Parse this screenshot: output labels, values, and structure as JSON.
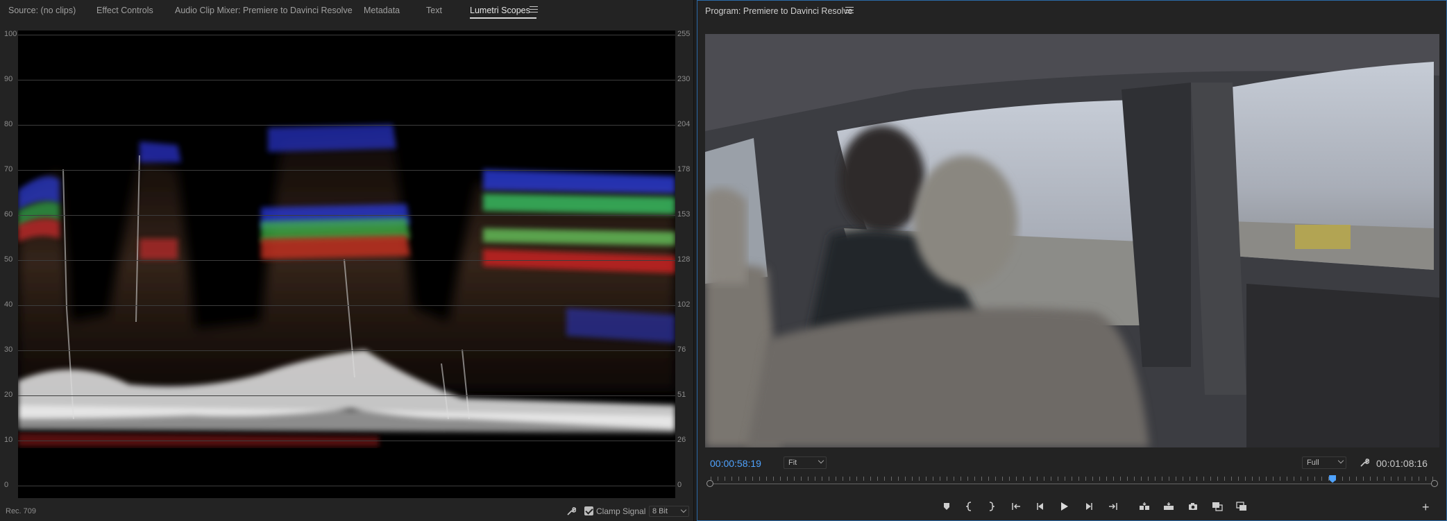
{
  "left_panel": {
    "tabs": [
      {
        "label": "Source: (no clips)"
      },
      {
        "label": "Effect Controls"
      },
      {
        "label": "Audio Clip Mixer: Premiere to Davinci Resolve"
      },
      {
        "label": "Metadata"
      },
      {
        "label": "Text"
      },
      {
        "label": "Lumetri Scopes",
        "active": true
      }
    ],
    "scope": {
      "type": "RGB parade waveform",
      "left_scale": [
        "100",
        "90",
        "80",
        "70",
        "60",
        "50",
        "40",
        "30",
        "20",
        "10",
        "0"
      ],
      "right_scale": [
        "255",
        "230",
        "204",
        "178",
        "153",
        "128",
        "102",
        "76",
        "51",
        "26",
        "0"
      ]
    },
    "footer": {
      "color_space": "Rec. 709",
      "clamp_signal_label": "Clamp Signal",
      "clamp_signal_checked": true,
      "bit_depth": "8 Bit",
      "wrench_icon": "wrench-icon"
    }
  },
  "right_panel": {
    "title": "Program: Premiere to Davinci Resolve",
    "video_description_icon": "video-frame",
    "current_timecode": "00:00:58:19",
    "zoom": "Fit",
    "resolution": "Full",
    "duration_timecode": "00:01:08:16",
    "playhead_fraction": 0.86,
    "transport_icons": [
      "add-marker-icon",
      "mark-in-icon",
      "mark-out-icon",
      "go-to-in-icon",
      "step-back-icon",
      "play-icon",
      "step-forward-icon",
      "go-to-out-icon",
      "insert-icon",
      "overwrite-icon",
      "export-frame-icon",
      "comparison-view-icon",
      "toggle-proxies-icon",
      "add-button-icon"
    ]
  },
  "colors": {
    "accent_blue": "#4fa3ff",
    "panel_bg": "#232323",
    "active_border": "#2b6aa8"
  }
}
